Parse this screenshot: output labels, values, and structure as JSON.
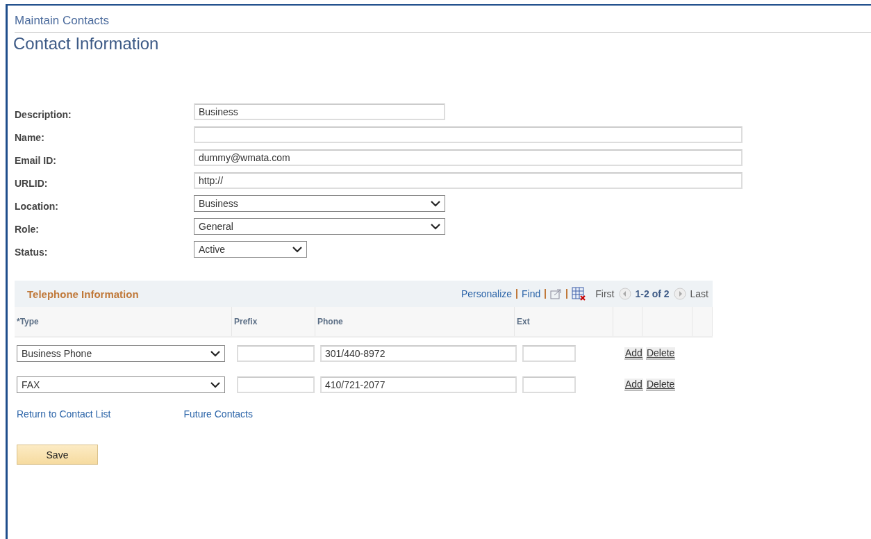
{
  "breadcrumb": "Maintain Contacts",
  "title": "Contact Information",
  "fields": [
    {
      "label": "Description:",
      "kind": "text",
      "value": "Business"
    },
    {
      "label": "Name:",
      "kind": "text"
    },
    {
      "label": "Email ID:",
      "kind": "text",
      "value": "dummy@wmata.com"
    },
    {
      "label": "URLID:",
      "kind": "text",
      "value": "http://"
    },
    {
      "label": "Location:",
      "kind": "select",
      "value": "Business"
    },
    {
      "label": "Role:",
      "kind": "select",
      "value": "General"
    },
    {
      "label": "Status:",
      "kind": "select",
      "value": "Active"
    }
  ],
  "telephone": {
    "title": "Telephone Information",
    "links": [
      "Personalize",
      "Find"
    ],
    "nav": {
      "first": "First",
      "range": "1-2 of 2",
      "last": "Last"
    },
    "columns": [
      "*Type",
      "Prefix",
      "Phone",
      "Ext"
    ],
    "rows": [
      {
        "type": "Business Phone",
        "phone": "301/440-8972",
        "add": "Add",
        "delete": "Delete"
      },
      {
        "type": "FAX",
        "phone": "410/721-2077",
        "add": "Add",
        "delete": "Delete"
      }
    ]
  },
  "links": [
    "Return to Contact List",
    "Future Contacts"
  ],
  "save": "Save"
}
